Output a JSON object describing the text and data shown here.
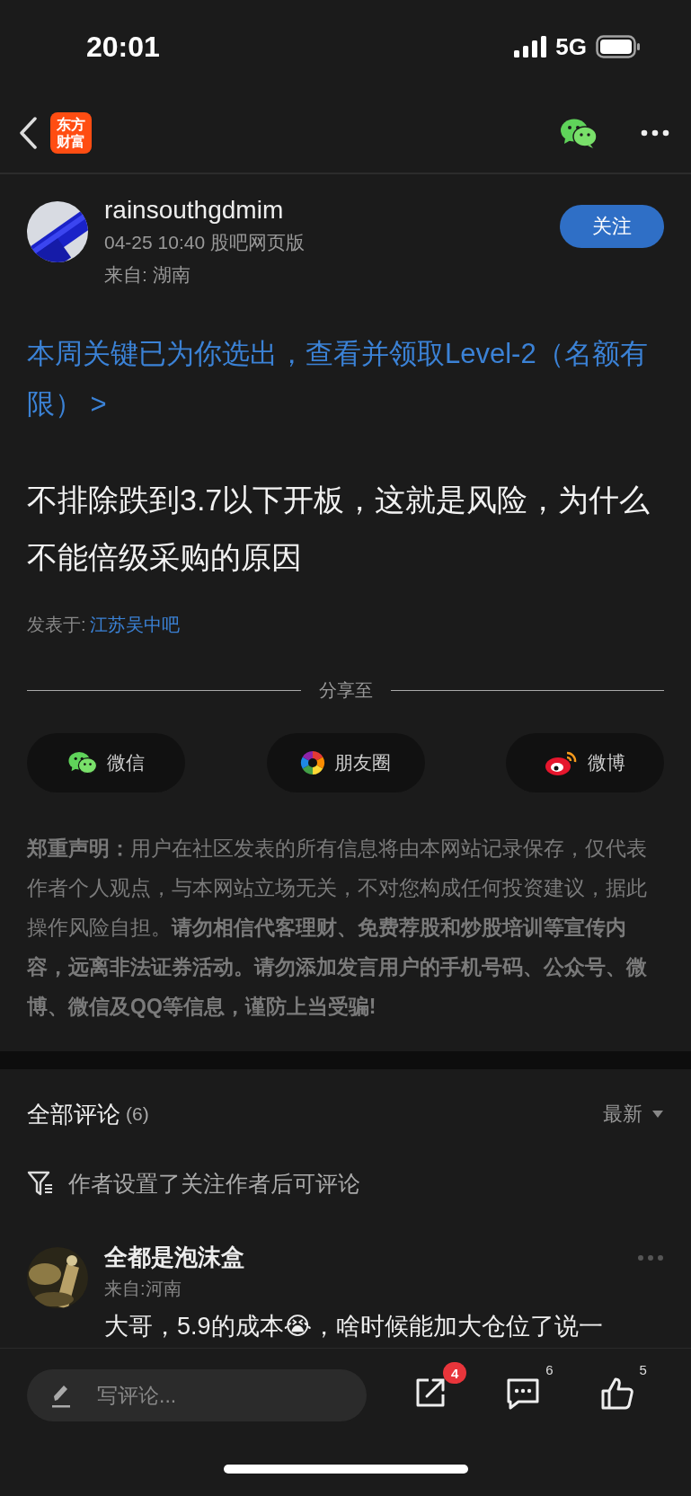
{
  "status_bar": {
    "time": "20:01",
    "network": "5G"
  },
  "nav": {
    "logo_lines": [
      "东方",
      "财富"
    ]
  },
  "post": {
    "author": "rainsouthgdmim",
    "meta": "04-25 10:40 股吧网页版",
    "location": "来自: 湖南",
    "follow_button": "关注",
    "promo_link": "本周关键已为你选出，查看并领取Level-2（名额有限） >",
    "body": "不排除跌到3.7以下开板，这就是风险，为什么不能倍级采购的原因",
    "posted_in_label": "发表于:",
    "posted_in": "江苏吴中吧"
  },
  "share": {
    "title": "分享至",
    "targets": [
      {
        "kind": "wechat",
        "label": "微信"
      },
      {
        "kind": "moments",
        "label": "朋友圈"
      },
      {
        "kind": "weibo",
        "label": "微博"
      }
    ]
  },
  "disclaimer": "**郑重声明：**用户在社区发表的所有信息将由本网站记录保存，仅代表作者个人观点，与本网站立场无关，不对您构成任何投资建议，据此操作风险自担。**请勿相信代客理财、免费荐股和炒股培训等宣传内容，远离非法证券活动。请勿添加发言用户的手机号码、公众号、微博、微信及QQ等信息，谨防上当受骗!**",
  "comments": {
    "title": "全部评论",
    "count": "(6)",
    "sort": "最新",
    "notice": "作者设置了关注作者后可评论",
    "items": [
      {
        "author": "全都是泡沫盒",
        "location": "来自:河南",
        "text": "大哥，5.9的成本😭，啥时候能加大仓位了说一"
      }
    ]
  },
  "bottom_bar": {
    "placeholder": "写评论...",
    "share_badge": "4",
    "comment_count": "6",
    "like_count": "5"
  }
}
